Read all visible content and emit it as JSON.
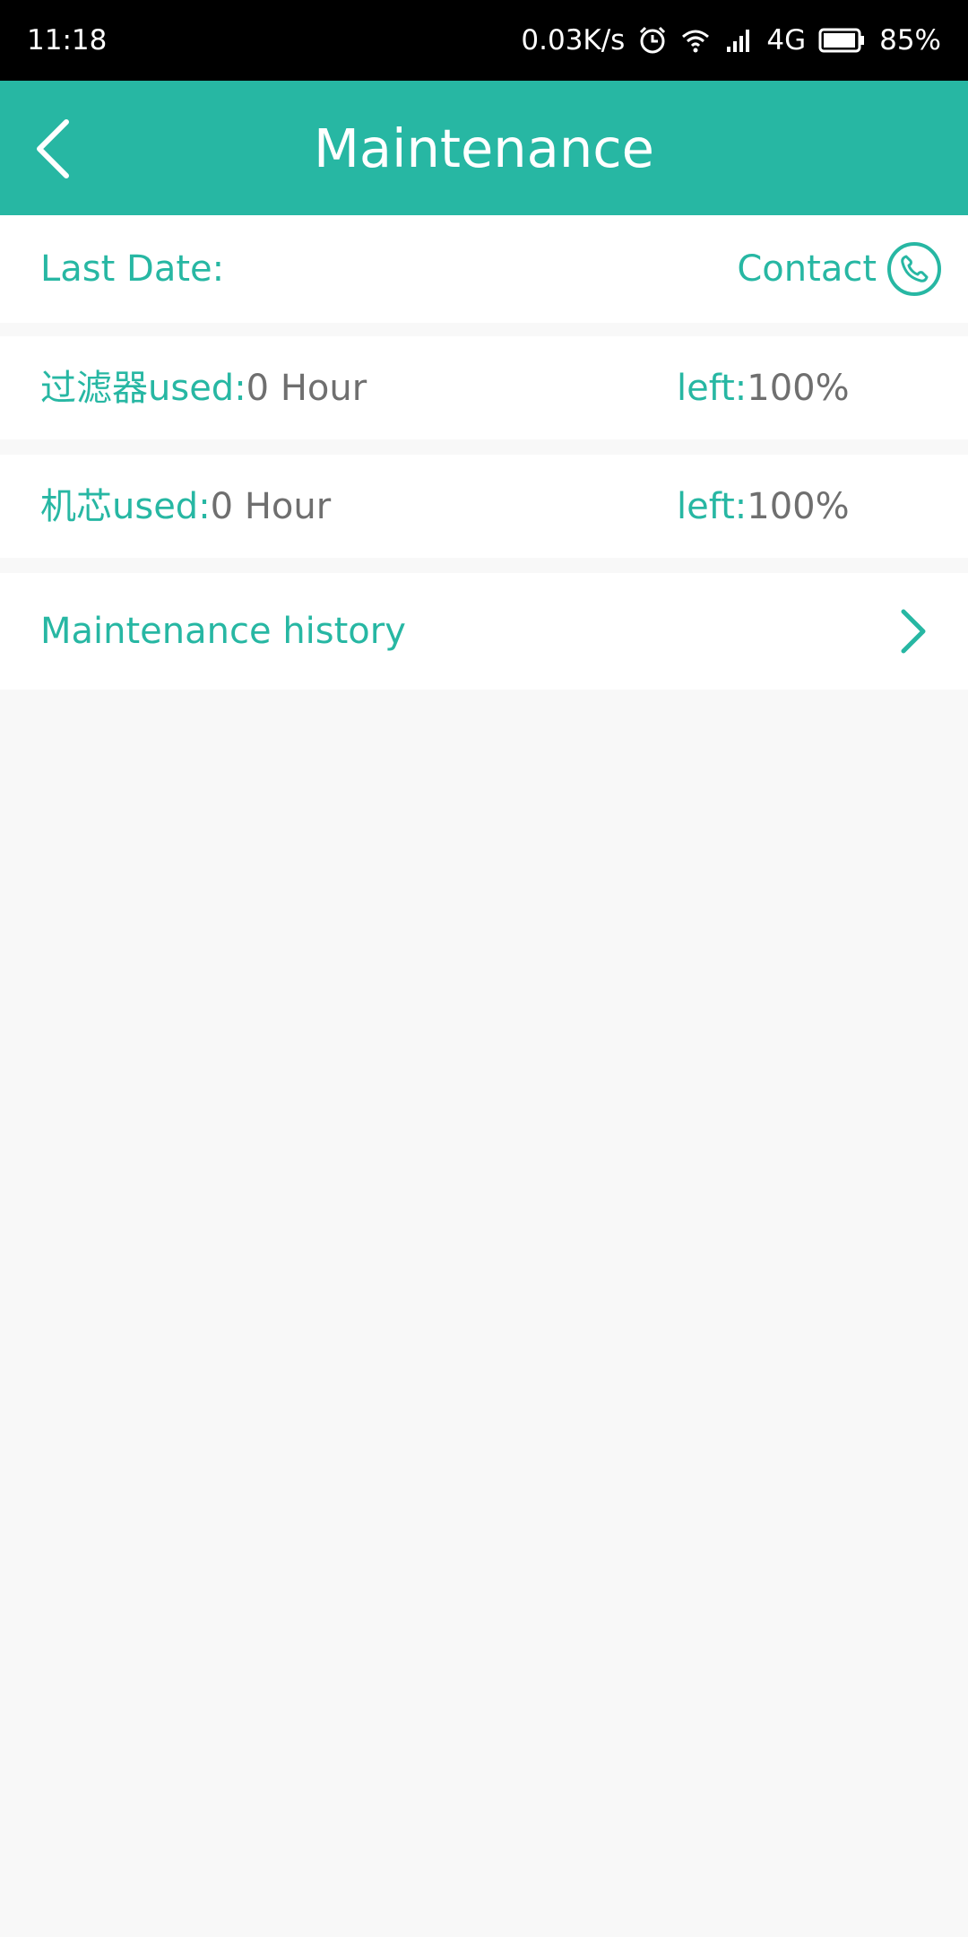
{
  "status_bar": {
    "time": "11:18",
    "speed": "0.03K/s",
    "network": "4G",
    "battery": "85%",
    "icons": [
      "alarm-icon",
      "wifi-icon",
      "signal-icon",
      "battery-icon"
    ]
  },
  "app_bar": {
    "title": "Maintenance",
    "back_icon": "back-arrow-icon"
  },
  "info_row": {
    "last_date_label": "Last Date:",
    "contact_label": "Contact",
    "contact_icon": "phone-icon"
  },
  "filters": [
    {
      "name": "过滤器",
      "used_label": " used:",
      "used_value": "0 Hour",
      "left_label": "left:",
      "left_value": "100%"
    },
    {
      "name": "机芯",
      "used_label": " used:",
      "used_value": "0 Hour",
      "left_label": "left:",
      "left_value": "100%"
    }
  ],
  "history": {
    "label": "Maintenance history",
    "icon": "chevron-right-icon"
  },
  "colors": {
    "accent": "#27b7a3",
    "background": "#f8f8f8",
    "status_bar": "#000000",
    "value_text": "#6f6f6f"
  }
}
